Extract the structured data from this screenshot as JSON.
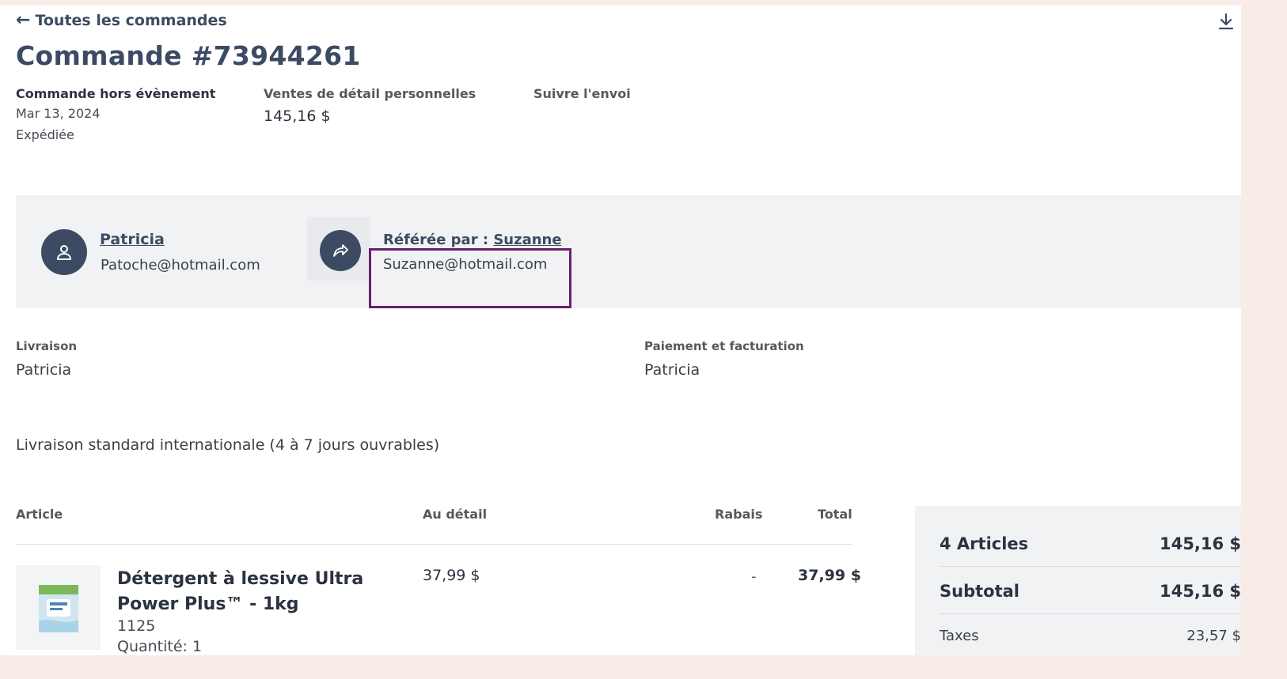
{
  "nav": {
    "back_label": "Toutes les commandes"
  },
  "order": {
    "title": "Commande #73944261"
  },
  "meta": {
    "type_label": "Commande hors évènement",
    "date": "Mar 13, 2024",
    "status": "Expédiée",
    "sales_label": "Ventes de détail personnelles",
    "sales_value": "145,16 $",
    "tracking_label": "Suivre l'envoi"
  },
  "customer": {
    "name": "Patricia",
    "email": "Patoche@hotmail.com"
  },
  "referrer": {
    "prefix": "Référée par : ",
    "name": "Suzanne",
    "email": "Suzanne@hotmail.com"
  },
  "shipping_address": {
    "label": "Livraison",
    "name": "Patricia"
  },
  "billing": {
    "label": "Paiement et facturation",
    "name": "Patricia"
  },
  "shipping_method": "Livraison standard internationale (4 à 7 jours ouvrables)",
  "table": {
    "headers": {
      "article": "Article",
      "retail": "Au détail",
      "discount": "Rabais",
      "total": "Total"
    },
    "items": [
      {
        "name": "Détergent à lessive Ultra Power Plus™ - 1kg",
        "sku": "1125",
        "quantity": "Quantité: 1",
        "retail": "37,99 $",
        "discount": "-",
        "total": "37,99 $"
      }
    ]
  },
  "summary": {
    "articles_label": "4 Articles",
    "articles_value": "145,16 $",
    "subtotal_label": "Subtotal",
    "subtotal_value": "145,16 $",
    "taxes_label": "Taxes",
    "taxes_value": "23,57 $"
  },
  "colors": {
    "accent": "#3c4b63",
    "highlight": "#6a1f6d",
    "band": "#f1f2f4",
    "outer": "#f8ede6"
  },
  "icons": {
    "back": "arrow-left-icon",
    "download": "download-icon",
    "customer": "user-icon",
    "referrer": "share-icon"
  }
}
